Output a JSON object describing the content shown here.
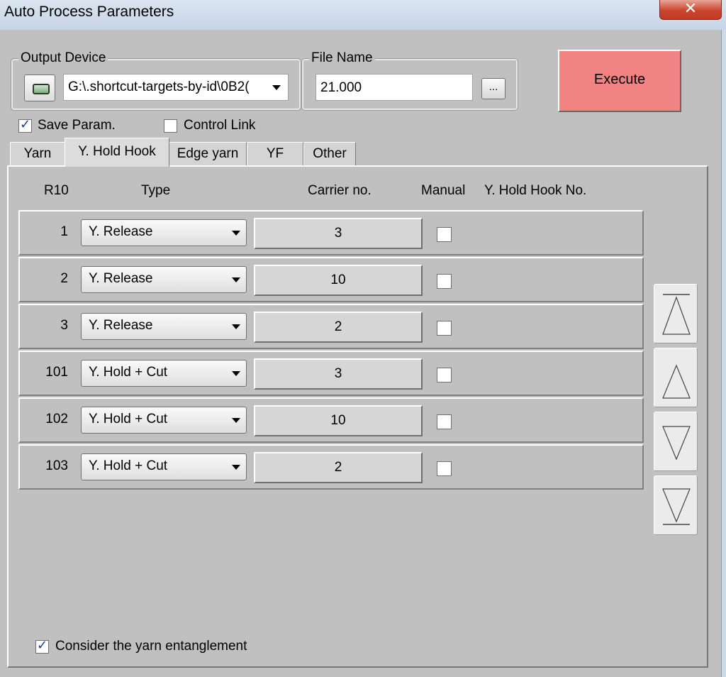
{
  "window": {
    "title": "Auto Process Parameters",
    "close_glyph": "✕"
  },
  "output_device": {
    "label": "Output Device",
    "icon": "disk-drive-icon",
    "value": "G:\\.shortcut-targets-by-id\\0B2("
  },
  "file_name": {
    "label": "File Name",
    "value": "21.000",
    "browse_label": "..."
  },
  "execute_label": "Execute",
  "options": {
    "save_param": {
      "label": "Save Param.",
      "checked": true
    },
    "control_link": {
      "label": "Control Link",
      "checked": false
    }
  },
  "tabs": [
    {
      "label": "Yarn",
      "active": false
    },
    {
      "label": "Y. Hold Hook",
      "active": true
    },
    {
      "label": "Edge yarn",
      "active": false
    },
    {
      "label": "YF",
      "active": false
    },
    {
      "label": "Other",
      "active": false
    }
  ],
  "columns": {
    "r10": "R10",
    "type": "Type",
    "carrier": "Carrier no.",
    "manual": "Manual",
    "hook_no": "Y. Hold Hook No."
  },
  "rows": [
    {
      "r10": "1",
      "type": "Y. Release",
      "carrier": "3",
      "manual": false
    },
    {
      "r10": "2",
      "type": "Y. Release",
      "carrier": "10",
      "manual": false
    },
    {
      "r10": "3",
      "type": "Y. Release",
      "carrier": "2",
      "manual": false
    },
    {
      "r10": "101",
      "type": "Y. Hold + Cut",
      "carrier": "3",
      "manual": false
    },
    {
      "r10": "102",
      "type": "Y. Hold + Cut",
      "carrier": "10",
      "manual": false
    },
    {
      "r10": "103",
      "type": "Y. Hold + Cut",
      "carrier": "2",
      "manual": false
    }
  ],
  "nav_buttons": [
    "move-top-icon",
    "move-up-icon",
    "move-down-icon",
    "move-bottom-icon"
  ],
  "consider_entanglement": {
    "label": "Consider the yarn entanglement",
    "checked": true
  }
}
